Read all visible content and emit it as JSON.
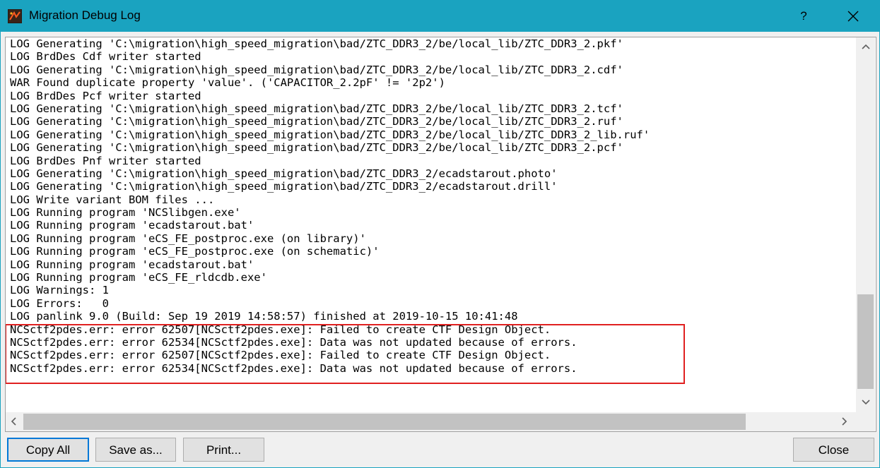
{
  "window": {
    "title": "Migration Debug Log",
    "help_label": "?",
    "titlebar_color": "#1aa3c0"
  },
  "log": {
    "lines": [
      "LOG Generating 'C:\\migration\\high_speed_migration\\bad/ZTC_DDR3_2/be/local_lib/ZTC_DDR3_2.pkf'",
      "LOG BrdDes Cdf writer started",
      "LOG Generating 'C:\\migration\\high_speed_migration\\bad/ZTC_DDR3_2/be/local_lib/ZTC_DDR3_2.cdf'",
      "WAR Found duplicate property 'value'. ('CAPACITOR_2.2pF' != '2p2')",
      "LOG BrdDes Pcf writer started",
      "LOG Generating 'C:\\migration\\high_speed_migration\\bad/ZTC_DDR3_2/be/local_lib/ZTC_DDR3_2.tcf'",
      "LOG Generating 'C:\\migration\\high_speed_migration\\bad/ZTC_DDR3_2/be/local_lib/ZTC_DDR3_2.ruf'",
      "LOG Generating 'C:\\migration\\high_speed_migration\\bad/ZTC_DDR3_2/be/local_lib/ZTC_DDR3_2_lib.ruf'",
      "LOG Generating 'C:\\migration\\high_speed_migration\\bad/ZTC_DDR3_2/be/local_lib/ZTC_DDR3_2.pcf'",
      "LOG BrdDes Pnf writer started",
      "LOG Generating 'C:\\migration\\high_speed_migration\\bad/ZTC_DDR3_2/ecadstarout.photo'",
      "LOG Generating 'C:\\migration\\high_speed_migration\\bad/ZTC_DDR3_2/ecadstarout.drill'",
      "LOG Write variant BOM files ...",
      "LOG Running program 'NCSlibgen.exe'",
      "LOG Running program 'ecadstarout.bat'",
      "LOG Running program 'eCS_FE_postproc.exe (on library)'",
      "LOG Running program 'eCS_FE_postproc.exe (on schematic)'",
      "LOG Running program 'ecadstarout.bat'",
      "LOG Running program 'eCS_FE_rldcdb.exe'",
      "LOG Warnings: 1",
      "LOG Errors:   0",
      "LOG panlink 9.0 (Build: Sep 19 2019 14:58:57) finished at 2019-10-15 10:41:48",
      "NCSctf2pdes.err: error 62507[NCSctf2pdes.exe]: Failed to create CTF Design Object.",
      "NCSctf2pdes.err: error 62534[NCSctf2pdes.exe]: Data was not updated because of errors.",
      "NCSctf2pdes.err: error 62507[NCSctf2pdes.exe]: Failed to create CTF Design Object.",
      "NCSctf2pdes.err: error 62534[NCSctf2pdes.exe]: Data was not updated because of errors."
    ],
    "highlight_color": "#e02020"
  },
  "buttons": {
    "copy_all": "Copy All",
    "save_as": "Save as...",
    "print": "Print...",
    "close": "Close"
  }
}
